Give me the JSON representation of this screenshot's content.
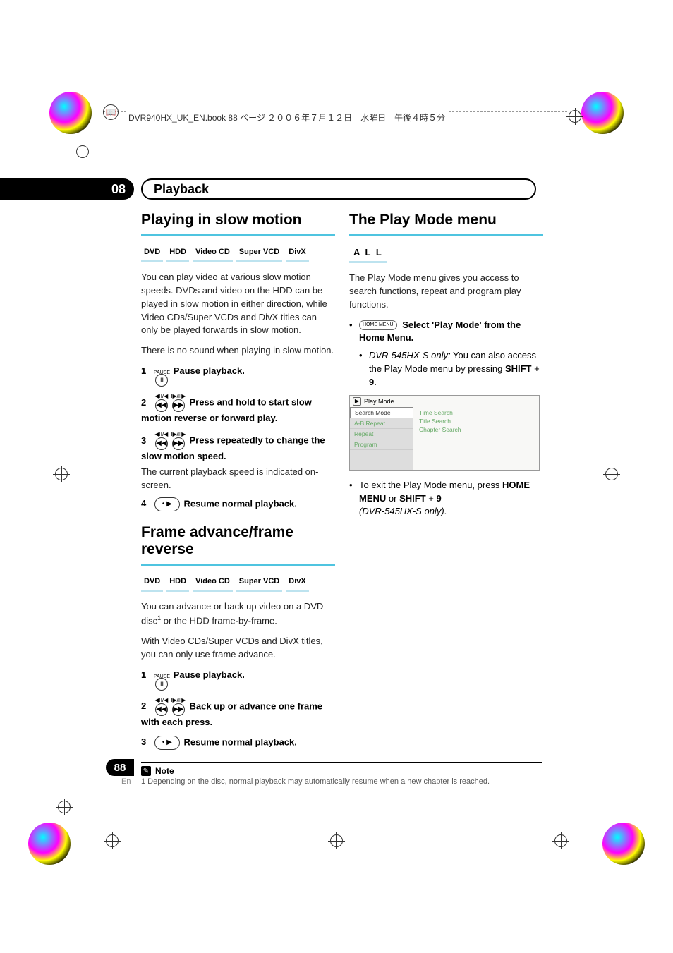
{
  "header_text": "DVR940HX_UK_EN.book  88 ページ  ２００６年７月１２日　水曜日　午後４時５分",
  "chapter": {
    "num": "08",
    "title": "Playback"
  },
  "left": {
    "s1_title": "Playing in slow motion",
    "media1": [
      "DVD",
      "HDD",
      "Video CD",
      "Super VCD",
      "DivX"
    ],
    "p1": "You can play video at various slow motion speeds. DVDs and video on the HDD can be played in slow motion in either direction, while Video CDs/Super VCDs and DivX titles can only be played forwards in slow motion.",
    "p2": "There is no sound when playing in slow motion.",
    "pause_label": "PAUSE",
    "step1_num": "1",
    "step1_text": "Pause playback.",
    "step2_num": "2",
    "step2_text": "Press and hold to start slow motion reverse or forward play.",
    "step3_num": "3",
    "step3_text": "Press repeatedly to change the slow motion speed.",
    "step3_sub": "The current playback speed is indicated on-screen.",
    "step4_num": "4",
    "step4_text": "Resume normal playback.",
    "s2_title": "Frame advance/frame reverse",
    "media2": [
      "DVD",
      "HDD",
      "Video CD",
      "Super VCD",
      "DivX"
    ],
    "p3a": "You can advance or back up video on a DVD disc",
    "p3b": " or the HDD frame-by-frame.",
    "p4": "With Video CDs/Super VCDs and DivX titles, you can only use frame advance.",
    "fstep1_num": "1",
    "fstep1_text": "Pause playback.",
    "fstep2_num": "2",
    "fstep2_text": "Back up or advance one frame with each press.",
    "fstep3_num": "3",
    "fstep3_text": "Resume normal playback."
  },
  "right": {
    "s1_title": "The Play Mode menu",
    "all_badge": "A L L",
    "p1": "The Play Mode menu gives you access to search functions, repeat and program play functions.",
    "home_menu_btn": "HOME MENU",
    "bullet1": "Select 'Play Mode' from the Home Menu.",
    "sub1_a": "DVR-545HX-S only:",
    "sub1_b": " You can also access the Play Mode menu by pressing ",
    "sub1_c": "SHIFT",
    "sub1_d": " + ",
    "sub1_e": "9",
    "sub1_f": ".",
    "pm_title": "Play Mode",
    "pm_left": [
      "Search Mode",
      "A-B Repeat",
      "Repeat",
      "Program"
    ],
    "pm_right": [
      "Time Search",
      "Title Search",
      "Chapter Search"
    ],
    "exit_a": "To exit the Play Mode menu, press ",
    "exit_b": "HOME MENU",
    "exit_c": " or ",
    "exit_d": "SHIFT",
    "exit_e": " + ",
    "exit_f": "9",
    "exit_g": "(DVR-545HX-S only)",
    "exit_h": "."
  },
  "footnote": {
    "note_label": "Note",
    "text": "1 Depending on the disc, normal playback may automatically resume when a new chapter is reached."
  },
  "page": {
    "num": "88",
    "lang": "En"
  }
}
